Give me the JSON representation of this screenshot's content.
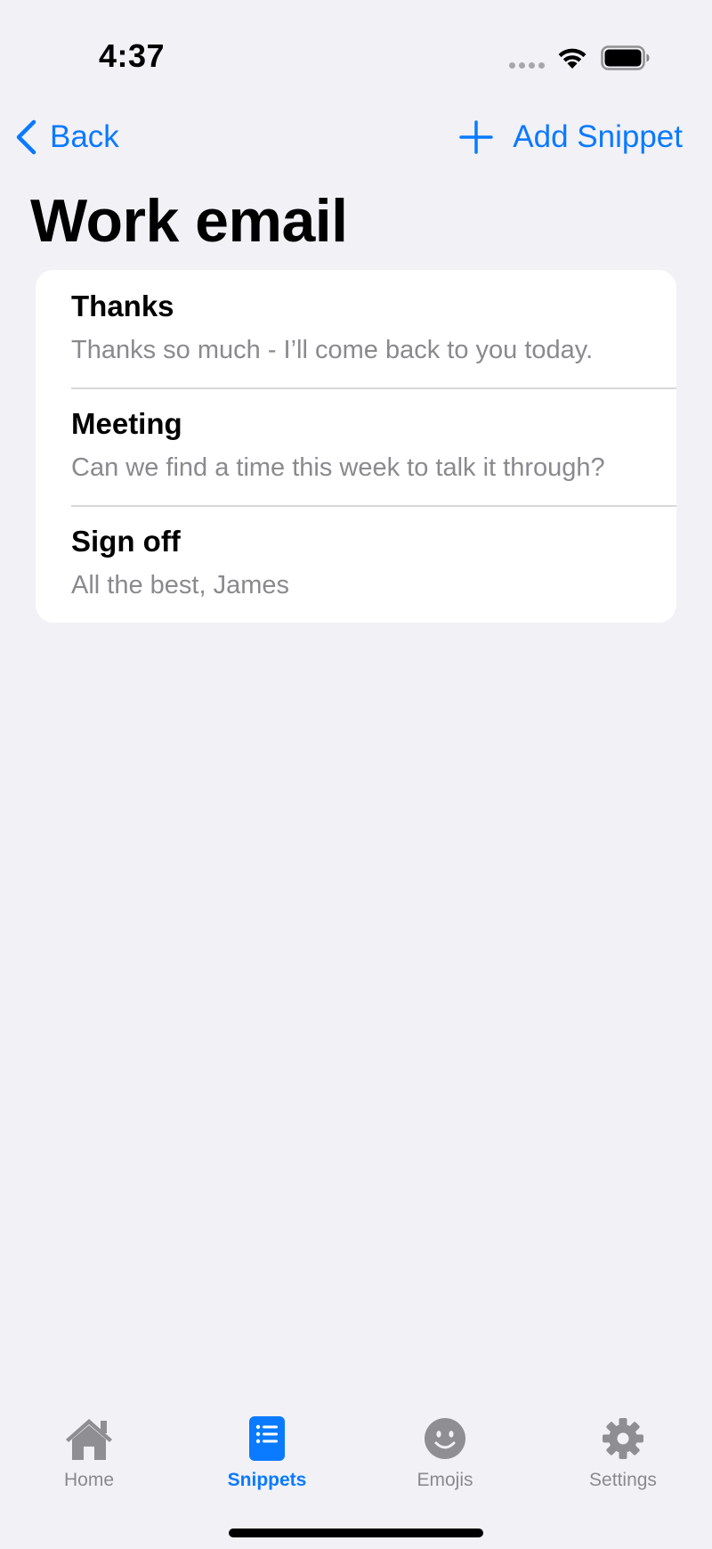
{
  "status_bar": {
    "time": "4:37"
  },
  "nav": {
    "back_label": "Back",
    "add_label": "Add Snippet"
  },
  "page": {
    "title": "Work email"
  },
  "snippets": [
    {
      "title": "Thanks",
      "body": "Thanks so much - I’ll come back to you today."
    },
    {
      "title": "Meeting",
      "body": "Can we find a time this week to talk it through?"
    },
    {
      "title": "Sign off",
      "body": "All the best, James"
    }
  ],
  "tabs": [
    {
      "label": "Home",
      "icon": "home-icon",
      "active": false
    },
    {
      "label": "Snippets",
      "icon": "snippets-icon",
      "active": true
    },
    {
      "label": "Emojis",
      "icon": "emoji-icon",
      "active": false
    },
    {
      "label": "Settings",
      "icon": "gear-icon",
      "active": false
    }
  ],
  "colors": {
    "accent": "#0a7aff",
    "background": "#f2f1f6",
    "secondary_text": "#8a8a8e",
    "inactive_icon": "#8e8e93"
  }
}
